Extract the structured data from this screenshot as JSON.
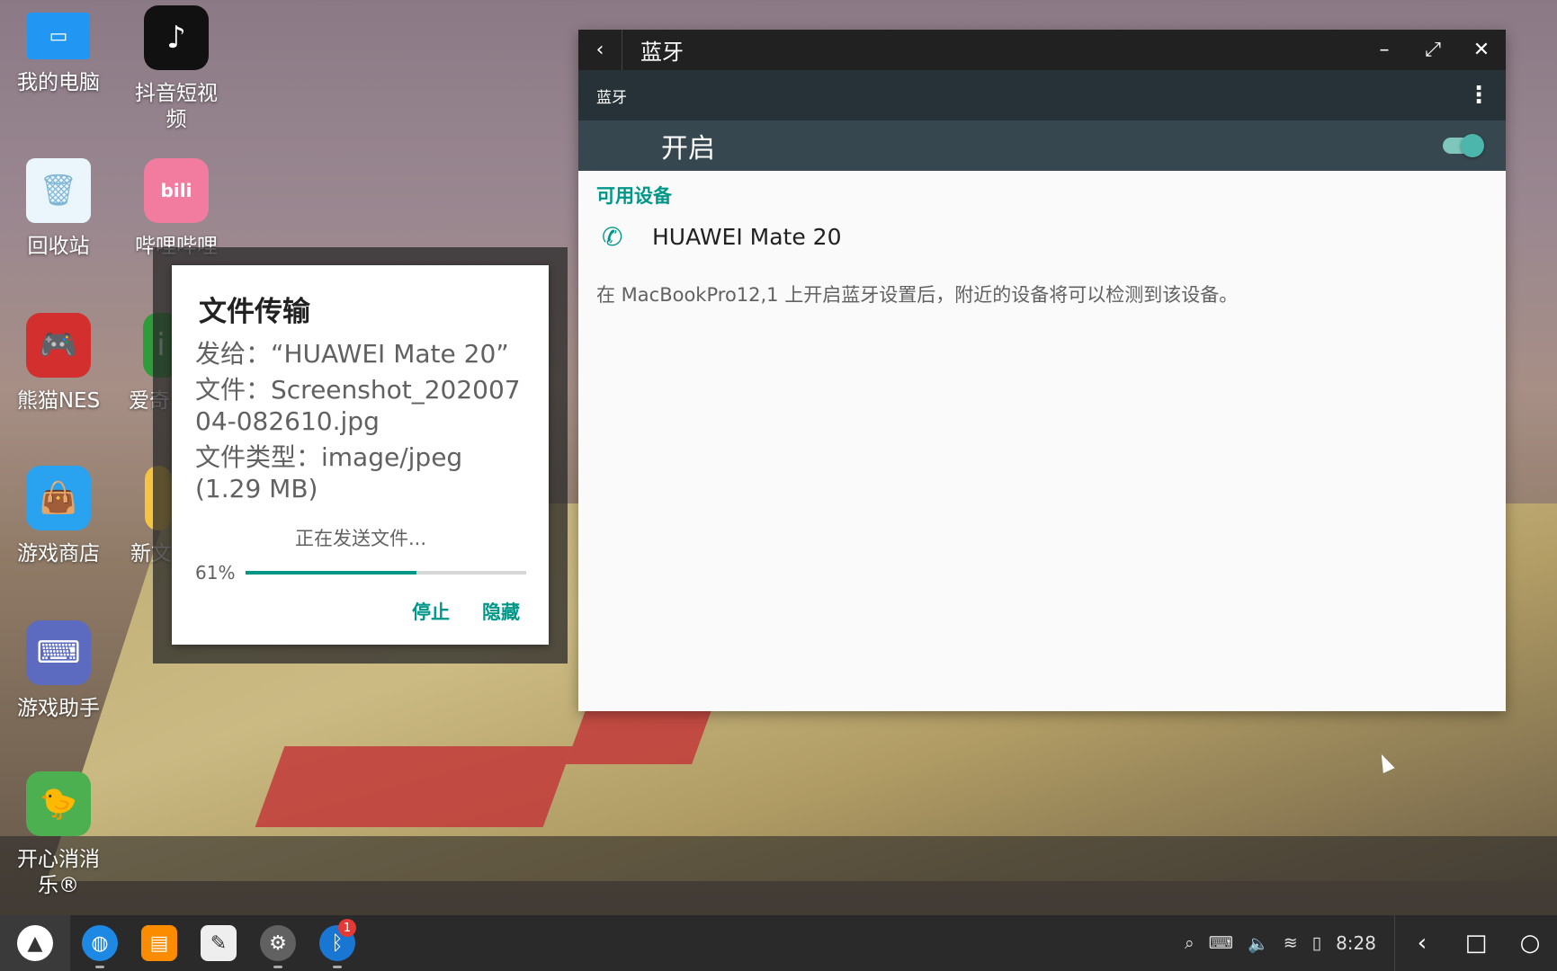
{
  "desktop": {
    "icons": [
      {
        "label": "我的电脑"
      },
      {
        "label": "抖音短视频"
      },
      {
        "label": "回收站"
      },
      {
        "label": "哔哩哔哩"
      },
      {
        "label": "熊猫NES"
      },
      {
        "label": "爱奇"
      },
      {
        "label": "游戏商店"
      },
      {
        "label": "新文"
      },
      {
        "label": "游戏助手"
      },
      {
        "label": "开心消消乐®"
      }
    ]
  },
  "bluetooth_window": {
    "title": "蓝牙",
    "toolbar_title": "蓝牙",
    "switch_label": "开启",
    "switch_on": true,
    "section": "可用设备",
    "device_name": "HUAWEI Mate 20",
    "note": "在 MacBookPro12,1 上开启蓝牙设置后，附近的设备将可以检测到该设备。"
  },
  "transfer_dialog": {
    "title": "文件传输",
    "send_to": "发给：“HUAWEI Mate 20”",
    "file": "文件：Screenshot_20200704-082610.jpg",
    "file_type": "文件类型：image/jpeg (1.29 MB)",
    "status": "正在发送文件...",
    "progress_label": "61%",
    "progress": 0.61,
    "stop_label": "停止",
    "hide_label": "隐藏"
  },
  "taskbar": {
    "badge": "1",
    "time": "8:28"
  },
  "colors": {
    "accent": "#009688",
    "toolbar": "#263238",
    "switchbar": "#37474f",
    "titlebar": "#212121"
  }
}
